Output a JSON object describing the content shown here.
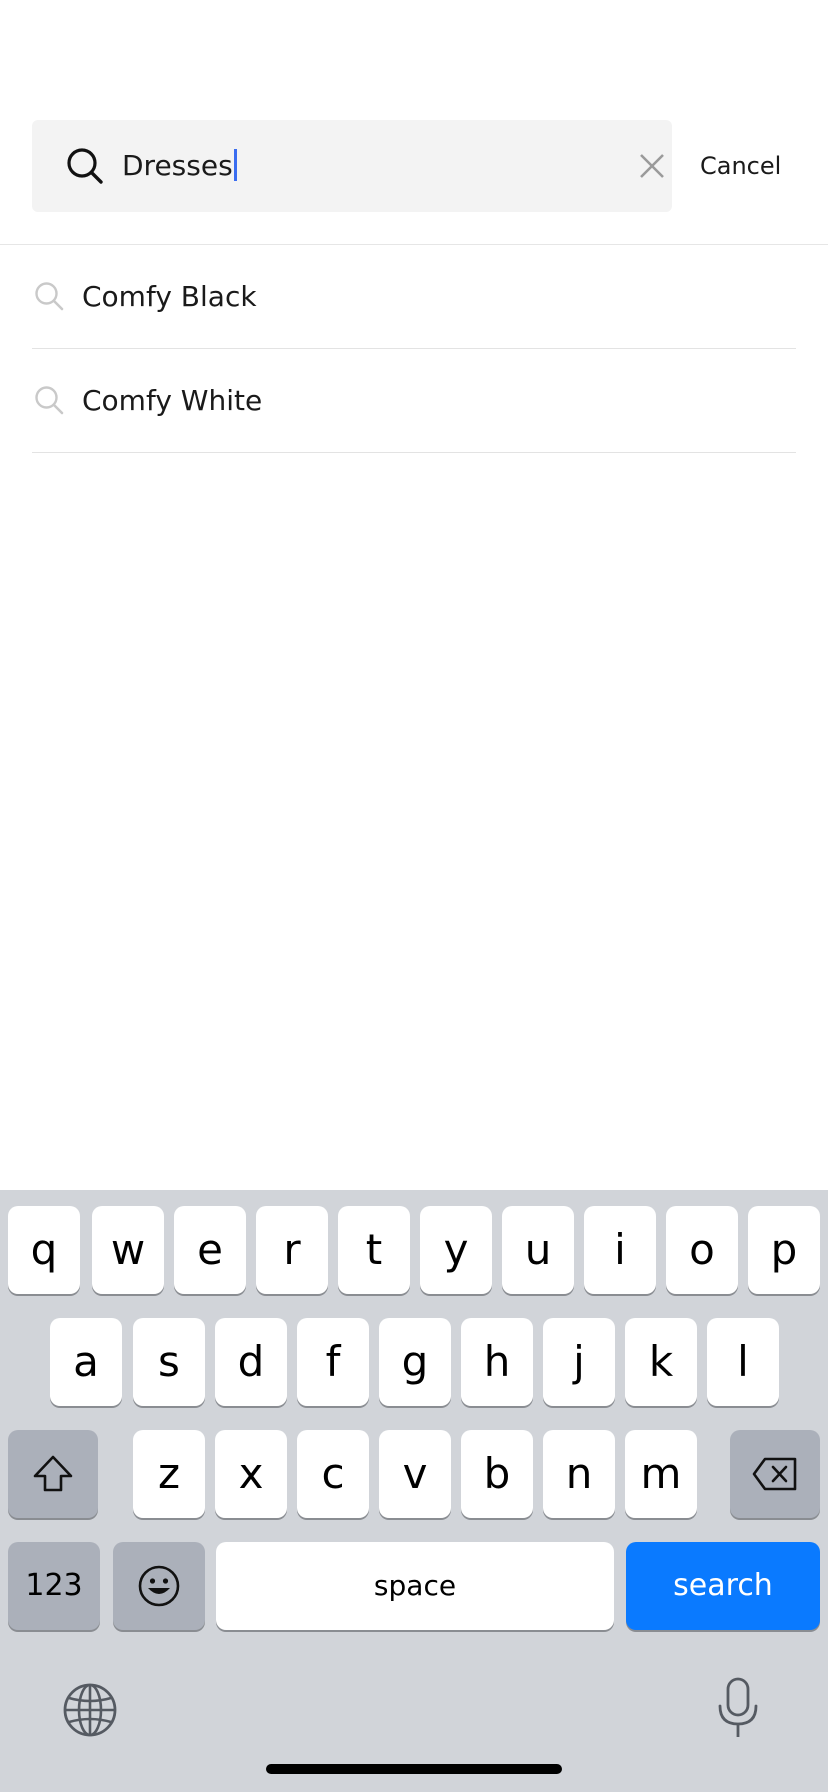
{
  "search": {
    "value": "Dresses",
    "cancel_label": "Cancel"
  },
  "suggestions": [
    {
      "label": "Comfy Black",
      "icon": "search-icon"
    },
    {
      "label": "Comfy White",
      "icon": "search-icon"
    }
  ],
  "keyboard": {
    "row1": [
      "q",
      "w",
      "e",
      "r",
      "t",
      "y",
      "u",
      "i",
      "o",
      "p"
    ],
    "row2": [
      "a",
      "s",
      "d",
      "f",
      "g",
      "h",
      "j",
      "k",
      "l"
    ],
    "row3": [
      "z",
      "x",
      "c",
      "v",
      "b",
      "n",
      "m"
    ],
    "numbers_label": "123",
    "space_label": "space",
    "search_label": "search",
    "accent_color": "#0a7aff"
  }
}
